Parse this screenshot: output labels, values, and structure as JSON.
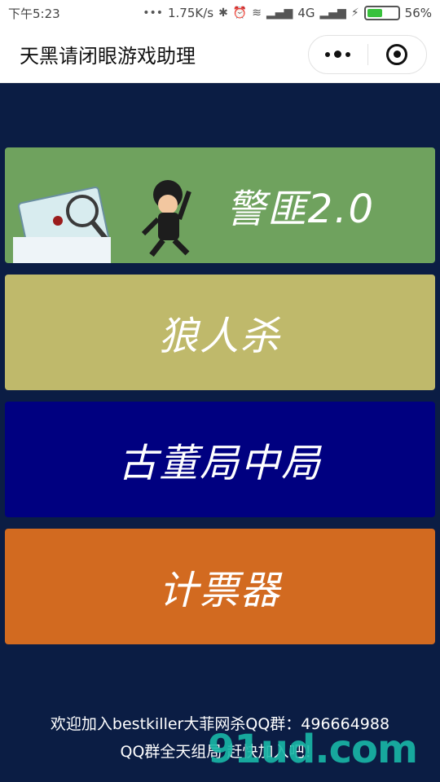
{
  "status_bar": {
    "time": "下午5:23",
    "network_speed": "1.75K/s",
    "network_type": "4G",
    "battery": "56%",
    "battery_level": 0.56
  },
  "nav": {
    "title": "天黑请闭眼游戏助理"
  },
  "menu": {
    "police": "警匪2.0",
    "werewolf": "狼人杀",
    "antique": "古董局中局",
    "counter": "计票器"
  },
  "footer": {
    "line1": "欢迎加入bestkiller大菲网杀QQ群：496664988",
    "line2": "QQ群全天组局 赶快加入吧！"
  },
  "watermark": "91ud.com",
  "colors": {
    "background": "#0b1d44",
    "police_card": "#6fa25e",
    "werewolf_card": "#bfb96b",
    "antique_card": "#000080",
    "counter_card": "#d26a20"
  }
}
